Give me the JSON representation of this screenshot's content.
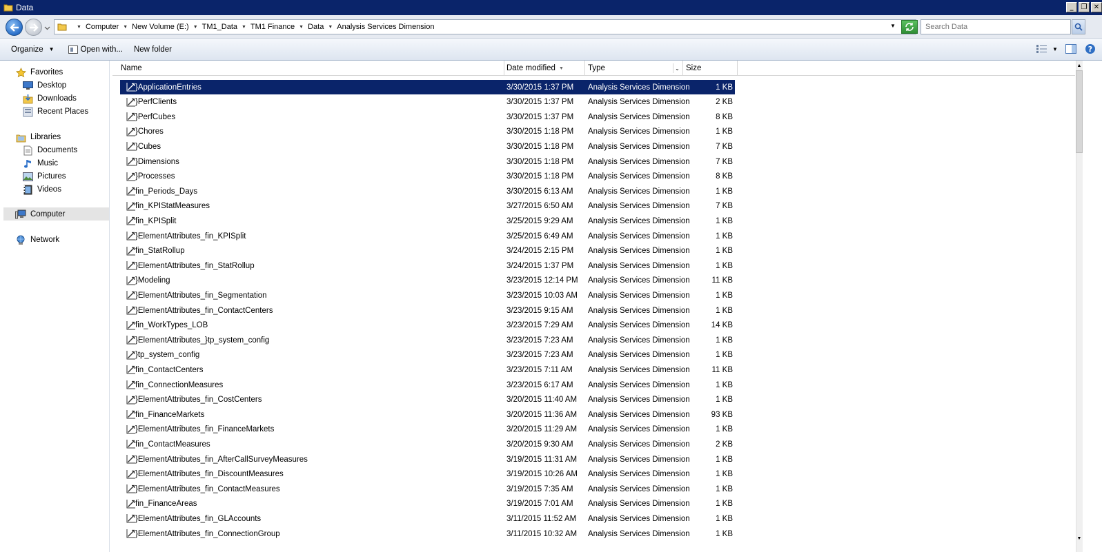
{
  "window": {
    "title": "Data"
  },
  "address": {
    "crumbs": [
      "Computer",
      "New Volume (E:)",
      "TM1_Data",
      "TM1 Finance",
      "Data",
      "Analysis Services Dimension"
    ]
  },
  "search": {
    "placeholder": "Search Data"
  },
  "toolbar": {
    "organize": "Organize",
    "open_with": "Open with...",
    "new_folder": "New folder"
  },
  "nav": {
    "favorites": "Favorites",
    "desktop": "Desktop",
    "downloads": "Downloads",
    "recent": "Recent Places",
    "libraries": "Libraries",
    "documents": "Documents",
    "music": "Music",
    "pictures": "Pictures",
    "videos": "Videos",
    "computer": "Computer",
    "network": "Network"
  },
  "columns": {
    "name": "Name",
    "date": "Date modified",
    "type": "Type",
    "size": "Size"
  },
  "files": [
    {
      "name": "}ApplicationEntries",
      "date": "3/30/2015 1:37 PM",
      "type": "Analysis Services Dimension",
      "size": "1 KB"
    },
    {
      "name": "}PerfClients",
      "date": "3/30/2015 1:37 PM",
      "type": "Analysis Services Dimension",
      "size": "2 KB"
    },
    {
      "name": "}PerfCubes",
      "date": "3/30/2015 1:37 PM",
      "type": "Analysis Services Dimension",
      "size": "8 KB"
    },
    {
      "name": "}Chores",
      "date": "3/30/2015 1:18 PM",
      "type": "Analysis Services Dimension",
      "size": "1 KB"
    },
    {
      "name": "}Cubes",
      "date": "3/30/2015 1:18 PM",
      "type": "Analysis Services Dimension",
      "size": "7 KB"
    },
    {
      "name": "}Dimensions",
      "date": "3/30/2015 1:18 PM",
      "type": "Analysis Services Dimension",
      "size": "7 KB"
    },
    {
      "name": "}Processes",
      "date": "3/30/2015 1:18 PM",
      "type": "Analysis Services Dimension",
      "size": "8 KB"
    },
    {
      "name": "fin_Periods_Days",
      "date": "3/30/2015 6:13 AM",
      "type": "Analysis Services Dimension",
      "size": "1 KB"
    },
    {
      "name": "fin_KPIStatMeasures",
      "date": "3/27/2015 6:50 AM",
      "type": "Analysis Services Dimension",
      "size": "7 KB"
    },
    {
      "name": "fin_KPISplit",
      "date": "3/25/2015 9:29 AM",
      "type": "Analysis Services Dimension",
      "size": "1 KB"
    },
    {
      "name": "}ElementAttributes_fin_KPISplit",
      "date": "3/25/2015 6:49 AM",
      "type": "Analysis Services Dimension",
      "size": "1 KB"
    },
    {
      "name": "fin_StatRollup",
      "date": "3/24/2015 2:15 PM",
      "type": "Analysis Services Dimension",
      "size": "1 KB"
    },
    {
      "name": "}ElementAttributes_fin_StatRollup",
      "date": "3/24/2015 1:37 PM",
      "type": "Analysis Services Dimension",
      "size": "1 KB"
    },
    {
      "name": "}Modeling",
      "date": "3/23/2015 12:14 PM",
      "type": "Analysis Services Dimension",
      "size": "11 KB"
    },
    {
      "name": "}ElementAttributes_fin_Segmentation",
      "date": "3/23/2015 10:03 AM",
      "type": "Analysis Services Dimension",
      "size": "1 KB"
    },
    {
      "name": "}ElementAttributes_fin_ContactCenters",
      "date": "3/23/2015 9:15 AM",
      "type": "Analysis Services Dimension",
      "size": "1 KB"
    },
    {
      "name": "fin_WorkTypes_LOB",
      "date": "3/23/2015 7:29 AM",
      "type": "Analysis Services Dimension",
      "size": "14 KB"
    },
    {
      "name": "}ElementAttributes_}tp_system_config",
      "date": "3/23/2015 7:23 AM",
      "type": "Analysis Services Dimension",
      "size": "1 KB"
    },
    {
      "name": "}tp_system_config",
      "date": "3/23/2015 7:23 AM",
      "type": "Analysis Services Dimension",
      "size": "1 KB"
    },
    {
      "name": "fin_ContactCenters",
      "date": "3/23/2015 7:11 AM",
      "type": "Analysis Services Dimension",
      "size": "11 KB"
    },
    {
      "name": "fin_ConnectionMeasures",
      "date": "3/23/2015 6:17 AM",
      "type": "Analysis Services Dimension",
      "size": "1 KB"
    },
    {
      "name": "}ElementAttributes_fin_CostCenters",
      "date": "3/20/2015 11:40 AM",
      "type": "Analysis Services Dimension",
      "size": "1 KB"
    },
    {
      "name": "fin_FinanceMarkets",
      "date": "3/20/2015 11:36 AM",
      "type": "Analysis Services Dimension",
      "size": "93 KB"
    },
    {
      "name": "}ElementAttributes_fin_FinanceMarkets",
      "date": "3/20/2015 11:29 AM",
      "type": "Analysis Services Dimension",
      "size": "1 KB"
    },
    {
      "name": "fin_ContactMeasures",
      "date": "3/20/2015 9:30 AM",
      "type": "Analysis Services Dimension",
      "size": "2 KB"
    },
    {
      "name": "}ElementAttributes_fin_AfterCallSurveyMeasures",
      "date": "3/19/2015 11:31 AM",
      "type": "Analysis Services Dimension",
      "size": "1 KB"
    },
    {
      "name": "}ElementAttributes_fin_DiscountMeasures",
      "date": "3/19/2015 10:26 AM",
      "type": "Analysis Services Dimension",
      "size": "1 KB"
    },
    {
      "name": "}ElementAttributes_fin_ContactMeasures",
      "date": "3/19/2015 7:35 AM",
      "type": "Analysis Services Dimension",
      "size": "1 KB"
    },
    {
      "name": "fin_FinanceAreas",
      "date": "3/19/2015 7:01 AM",
      "type": "Analysis Services Dimension",
      "size": "1 KB"
    },
    {
      "name": "}ElementAttributes_fin_GLAccounts",
      "date": "3/11/2015 11:52 AM",
      "type": "Analysis Services Dimension",
      "size": "1 KB"
    },
    {
      "name": "}ElementAttributes_fin_ConnectionGroup",
      "date": "3/11/2015 10:32 AM",
      "type": "Analysis Services Dimension",
      "size": "1 KB"
    }
  ],
  "selected_index": 0
}
